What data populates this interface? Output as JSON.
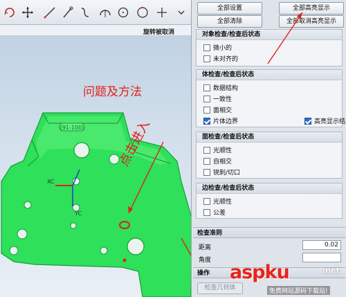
{
  "viewport": {
    "status_text": "旋转被取消",
    "problem_title": "问题及方法",
    "annotation_text": "点击进入",
    "part_label": "(91-100)",
    "axis_x_label": "XC",
    "axis_y_label": "YC",
    "toolbar_icons": [
      "rotate-icon",
      "pan-icon",
      "line-icon",
      "pen-icon",
      "curve-icon",
      "arc-icon",
      "circle-point-icon",
      "circle-icon",
      "crosshair-icon",
      "dropdown-icon"
    ]
  },
  "panel": {
    "buttons": {
      "all_settings": "全部设置",
      "all_highlight": "全部高亮显示",
      "all_clear": "全部清除",
      "all_unhighlight": "全部取消高亮显示"
    },
    "object_group": {
      "title": "对象检查/检查后状态",
      "items": [
        {
          "label": "微小的",
          "checked": false
        },
        {
          "label": "未对齐的",
          "checked": false
        }
      ]
    },
    "body_group": {
      "title": "体检查/检查后状态",
      "items": [
        {
          "label": "数据结构",
          "checked": false
        },
        {
          "label": "一致性",
          "checked": false
        },
        {
          "label": "面相交",
          "checked": false
        },
        {
          "label": "片体边界",
          "checked": true
        }
      ],
      "highlight_result": {
        "label": "高亮显示结果",
        "checked": true
      }
    },
    "face_group": {
      "title": "面检查/检查后状态",
      "items": [
        {
          "label": "光顺性",
          "checked": false
        },
        {
          "label": "自相交",
          "checked": false
        },
        {
          "label": "锐刺/切口",
          "checked": false
        }
      ]
    },
    "edge_group": {
      "title": "边检查/检查后状态",
      "items": [
        {
          "label": "光顺性",
          "checked": false
        },
        {
          "label": "公差",
          "checked": false
        }
      ]
    },
    "criteria": {
      "title": "检查准则",
      "distance_label": "距离",
      "distance_value": "0.02",
      "angle_label": "角度"
    },
    "operation": {
      "title": "操作",
      "check_button": "检查几何体"
    }
  },
  "watermark": {
    "brand": "aspku",
    "tld": ".net",
    "subtitle": "免费网站源码下载站!"
  },
  "colors": {
    "part_green": "#2ee05a",
    "annotation_red": "#e0201a",
    "checkbox_blue": "#2d6fd0"
  }
}
